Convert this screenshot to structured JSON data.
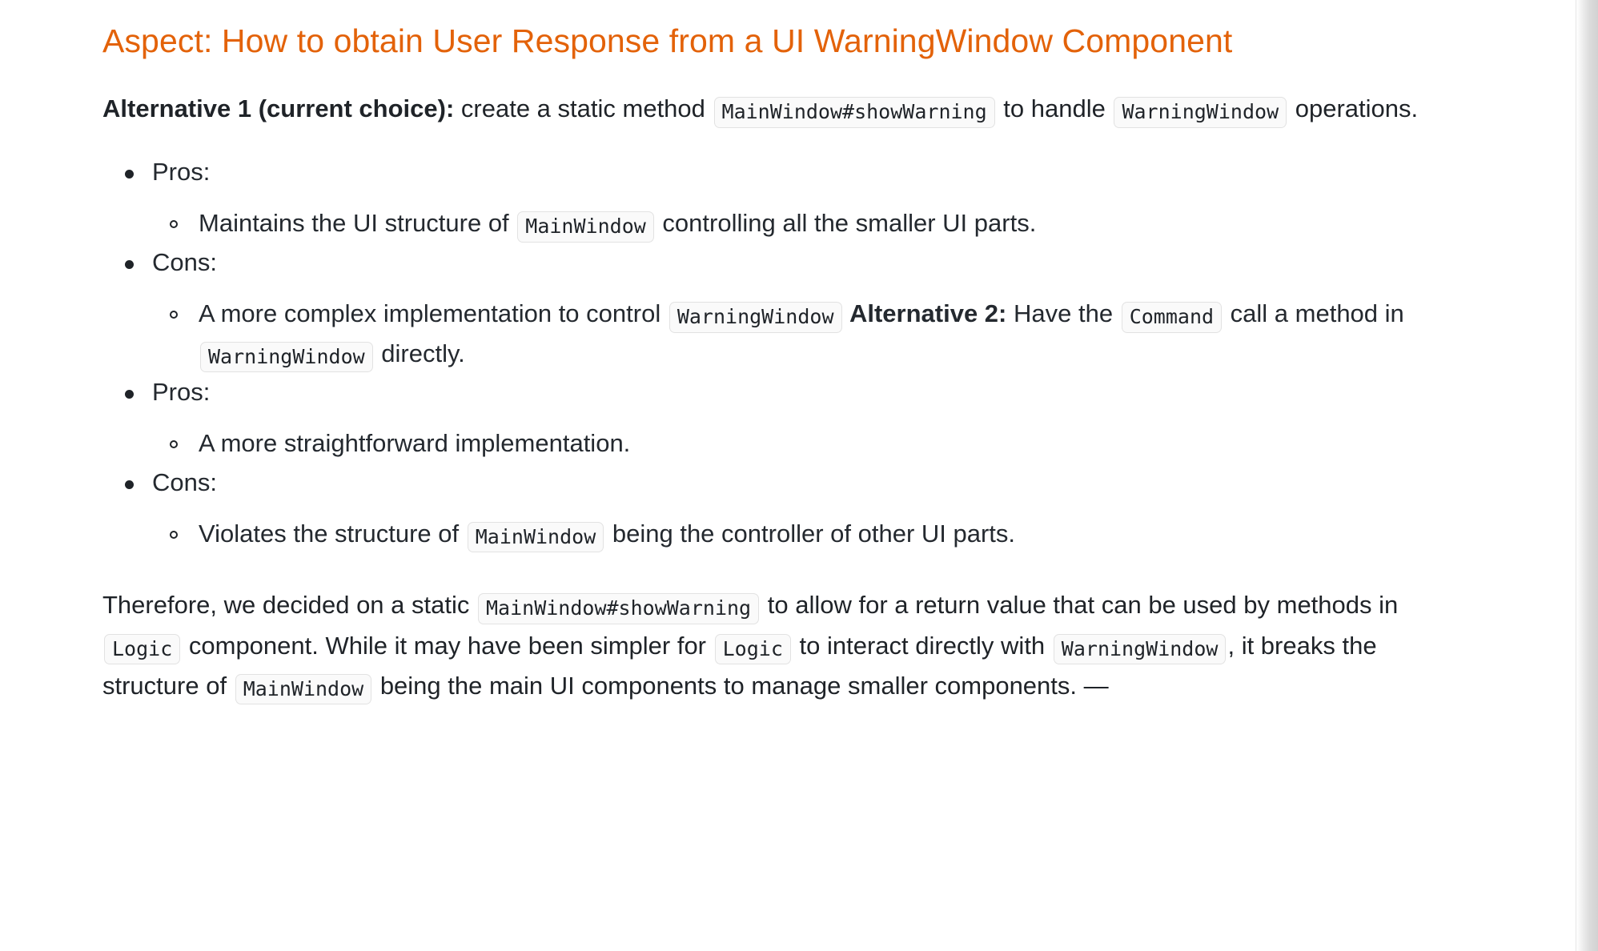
{
  "document": {
    "heading": "Aspect: How to obtain User Response from a UI WarningWindow Component",
    "alt1_paragraph": {
      "bold_lead": "Alternative 1 (current choice):",
      "text_1": " create a static method ",
      "code_1": "MainWindow#showWarning",
      "text_2": " to handle ",
      "code_2": "WarningWindow",
      "text_3": " operations."
    },
    "list": [
      {
        "label": "Pros:",
        "children": [
          {
            "parts": [
              {
                "type": "text",
                "value": "Maintains the UI structure of "
              },
              {
                "type": "code",
                "value": "MainWindow"
              },
              {
                "type": "text",
                "value": " controlling all the smaller UI parts."
              }
            ]
          }
        ]
      },
      {
        "label": "Cons:",
        "children": [
          {
            "parts": [
              {
                "type": "text",
                "value": "A more complex implementation to control "
              },
              {
                "type": "code",
                "value": "WarningWindow"
              },
              {
                "type": "bold",
                "value": " Alternative 2:"
              },
              {
                "type": "text",
                "value": " Have the "
              },
              {
                "type": "code",
                "value": "Command"
              },
              {
                "type": "text",
                "value": " call a method in "
              },
              {
                "type": "code",
                "value": "WarningWindow"
              },
              {
                "type": "text",
                "value": " directly."
              }
            ]
          }
        ]
      },
      {
        "label": "Pros:",
        "children": [
          {
            "parts": [
              {
                "type": "text",
                "value": "A more straightforward implementation."
              }
            ]
          }
        ]
      },
      {
        "label": "Cons:",
        "children": [
          {
            "parts": [
              {
                "type": "text",
                "value": "Violates the structure of "
              },
              {
                "type": "code",
                "value": "MainWindow"
              },
              {
                "type": "text",
                "value": " being the controller of other UI parts."
              }
            ]
          }
        ]
      }
    ],
    "conclusion": {
      "t1": "Therefore, we decided on a static ",
      "c1": "MainWindow#showWarning",
      "t2": " to allow for a return value that can be used by methods in ",
      "c2": "Logic",
      "t3": " component. While it may have been simpler for ",
      "c3": "Logic",
      "t4": " to interact directly with ",
      "c4": "WarningWindow",
      "t5": ", it breaks the structure of ",
      "c5": "MainWindow",
      "t6": " being the main UI components to manage smaller components. —"
    }
  },
  "colors": {
    "heading": "#e36209",
    "body_text": "#1f2328",
    "code_bg": "#fafafa",
    "code_border": "#e2e2e2",
    "scrollbar_track": "#dcdcdc"
  }
}
